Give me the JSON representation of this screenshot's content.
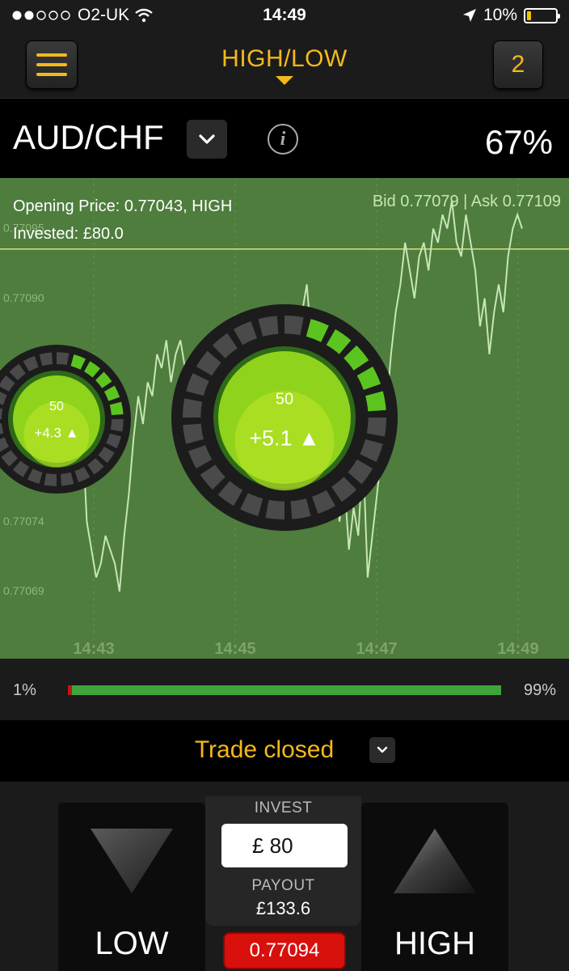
{
  "status_bar": {
    "carrier": "O2-UK",
    "time": "14:49",
    "battery": "10%"
  },
  "header": {
    "title": "HIGH/LOW",
    "open_trades_count": "2"
  },
  "asset": {
    "name": "AUD/CHF",
    "payout_percent": "67%"
  },
  "chart_info": {
    "opening_price": "Opening Price: 0.77043, HIGH",
    "invested": "Invested: £80.0",
    "bid_ask": "Bid 0.77079 | Ask 0.77109"
  },
  "chart_data": {
    "type": "line",
    "x_ticks": [
      "14:43",
      "14:45",
      "14:47",
      "14:49"
    ],
    "y_ticks": [
      "0.77095",
      "0.77090",
      "0.77074",
      "0.77069"
    ],
    "ylim": [
      0.77065,
      0.77097
    ],
    "current_level": 0.77094,
    "series": [
      {
        "values": [
          0.77082,
          0.7708,
          0.77081,
          0.77074,
          0.77072,
          0.7707,
          0.77071,
          0.77073,
          0.77072,
          0.77071,
          0.77069,
          0.77073,
          0.77076,
          0.7708,
          0.77083,
          0.77081,
          0.77084,
          0.77083,
          0.77086,
          0.77085,
          0.77087,
          0.77084,
          0.77086,
          0.77087,
          0.77085,
          0.77083,
          0.77081,
          0.77083,
          0.7708,
          0.77078,
          0.7708,
          0.77082,
          0.77079,
          0.77082,
          0.77085,
          0.77083,
          0.77086,
          0.77083,
          0.77084,
          0.77086,
          0.77083,
          0.77081,
          0.77083,
          0.7708,
          0.77082,
          0.77084,
          0.77081,
          0.77083,
          0.77085,
          0.77089,
          0.77091,
          0.77087,
          0.77083,
          0.77077,
          0.7708,
          0.77075,
          0.77078,
          0.77074,
          0.77077,
          0.77072,
          0.77075,
          0.77073,
          0.77079,
          0.7707,
          0.77073,
          0.77076,
          0.77079,
          0.77082,
          0.77086,
          0.77089,
          0.77091,
          0.77094,
          0.77092,
          0.7709,
          0.77093,
          0.77094,
          0.77092,
          0.77095,
          0.77094,
          0.77096,
          0.77095,
          0.77097,
          0.77094,
          0.77093,
          0.77096,
          0.77094,
          0.77092,
          0.77088,
          0.7709,
          0.77086,
          0.77089,
          0.77091,
          0.77089,
          0.77093,
          0.77095,
          0.77096,
          0.77095
        ]
      }
    ]
  },
  "bubbles": [
    {
      "amount": "50",
      "profit": "+4.3",
      "direction": "up"
    },
    {
      "amount": "50",
      "profit": "+5.1",
      "direction": "up"
    }
  ],
  "sentiment": {
    "low_percent": "1%",
    "high_percent": "99%",
    "low_fraction": 0.01
  },
  "trade": {
    "status": "Trade closed"
  },
  "controls": {
    "low_label": "LOW",
    "high_label": "HIGH",
    "invest_label": "INVEST",
    "invest_value": "£ 80",
    "payout_label": "PAYOUT",
    "payout_value": "£133.6",
    "current_price": "0.77094"
  },
  "colors": {
    "accent": "#f5b81c",
    "chart_bg": "#4e7d3d",
    "line": "#c7e6b5",
    "high_bar": "#3fa53a",
    "low_bar": "#c41515",
    "price_pill": "#d8100c"
  }
}
